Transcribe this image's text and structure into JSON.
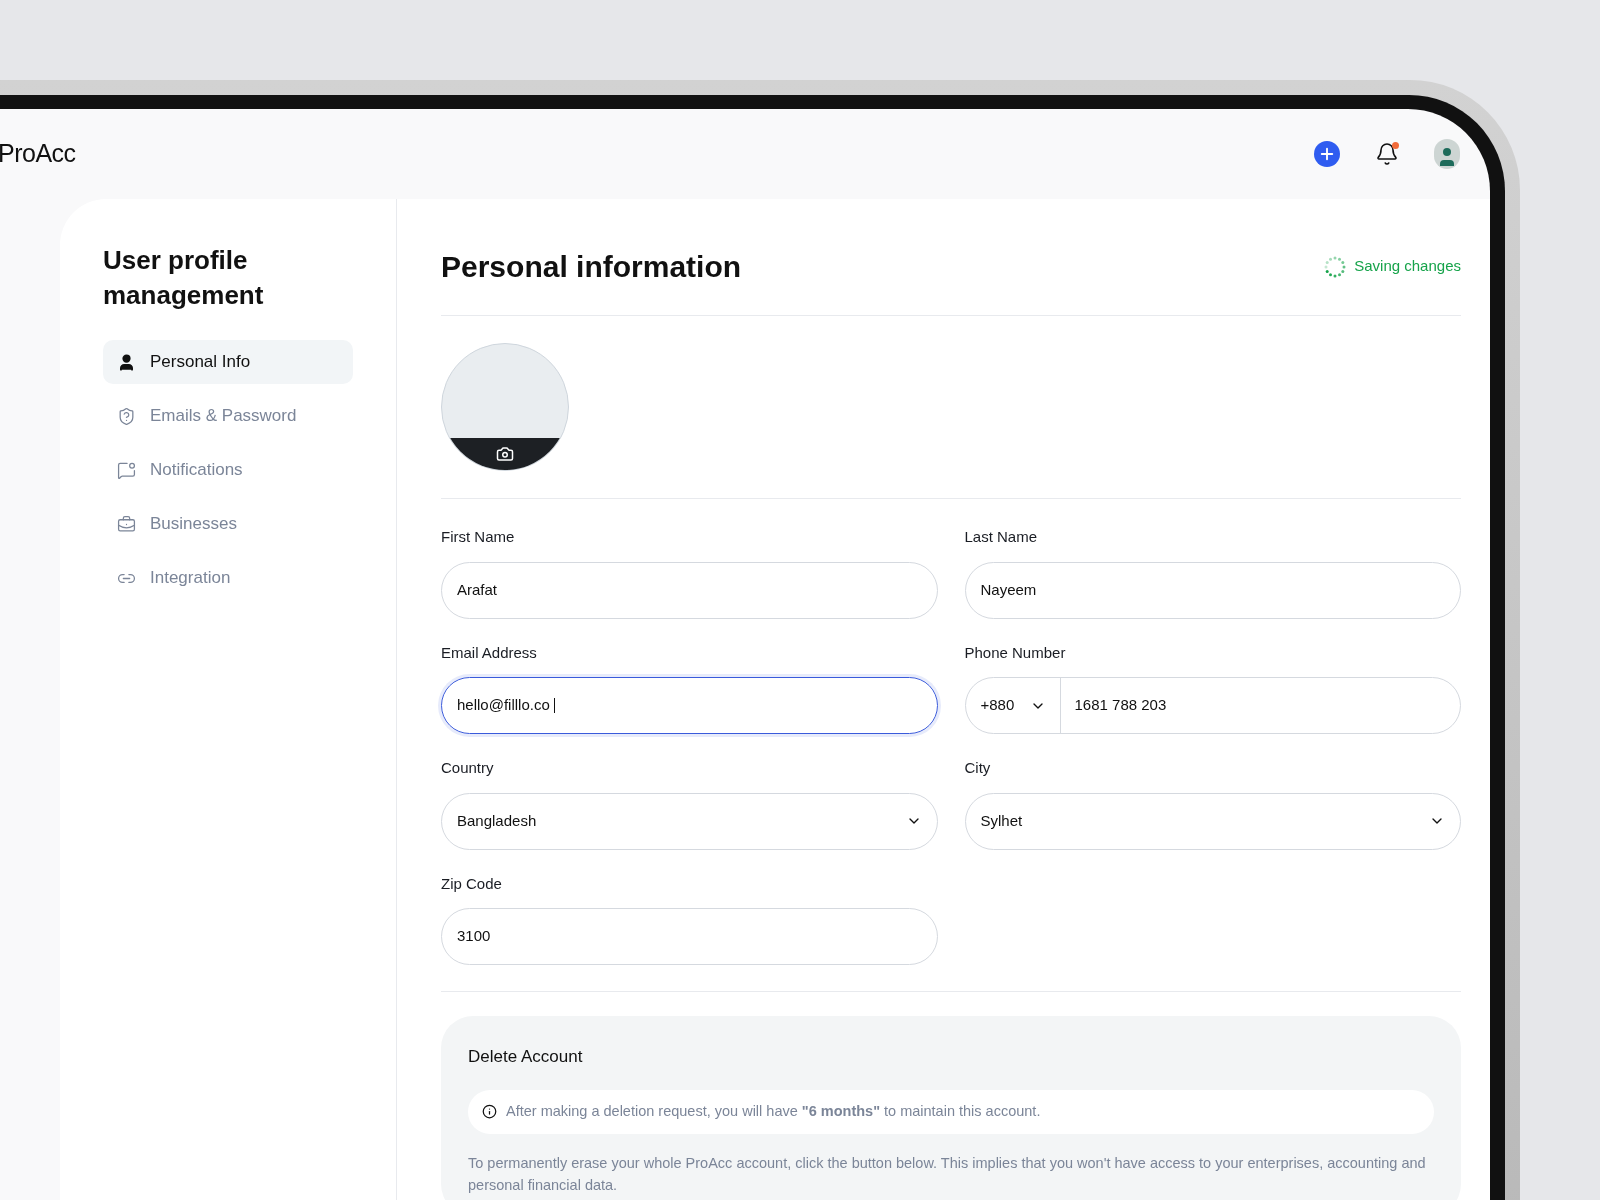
{
  "header": {
    "logo": "ProAcc"
  },
  "sidebar": {
    "title": "User profile management",
    "items": [
      {
        "label": "Personal Info",
        "selected": true
      },
      {
        "label": "Emails & Password",
        "selected": false
      },
      {
        "label": "Notifications",
        "selected": false
      },
      {
        "label": "Businesses",
        "selected": false
      },
      {
        "label": "Integration",
        "selected": false
      }
    ]
  },
  "content": {
    "title": "Personal information",
    "status": "Saving changes",
    "fields": [
      {
        "kind": "text",
        "label": "First Name",
        "value": "Arafat",
        "focused": false
      },
      {
        "kind": "text",
        "label": "Last Name",
        "value": "Nayeem",
        "focused": false
      },
      {
        "kind": "text",
        "label": "Email Address",
        "value": "hello@filllo.co",
        "focused": true
      },
      {
        "kind": "phone",
        "label": "Phone Number",
        "code": "+880",
        "value": "1681 788 203",
        "focused": false
      },
      {
        "kind": "select",
        "label": "Country",
        "value": "Bangladesh",
        "focused": false
      },
      {
        "kind": "select",
        "label": "City",
        "value": "Sylhet",
        "focused": false
      },
      {
        "kind": "text",
        "label": "Zip Code",
        "value": "3100",
        "focused": false
      }
    ],
    "delete": {
      "title": "Delete Account",
      "notice": "After making a deletion request, you will have **\"6 months\"** to maintain this account.",
      "text": "To permanently erase your whole ProAcc account, click the button below. This implies that you won't have access to your enterprises, accounting and personal financial data."
    }
  }
}
